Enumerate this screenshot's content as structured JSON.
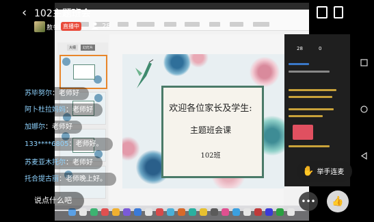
{
  "header": {
    "back_label": "‹",
    "title": "102主题班会",
    "host_name": "敖冬",
    "live_badge": "直播中",
    "viewer_icon": "person-icon",
    "viewer_count": "28"
  },
  "slide": {
    "greeting": "欢迎各位家长及学生:",
    "subtitle": "主题班会课",
    "class_name": "102班"
  },
  "ppt": {
    "tab_outline": "大纲",
    "tab_slides": "幻灯片"
  },
  "panel": {
    "stat_a": "28",
    "stat_b": "0"
  },
  "chat": [
    {
      "user": "苏毕努尔",
      "message": "老师好"
    },
    {
      "user": "阿卜杜拉妈妈",
      "message": "老师好"
    },
    {
      "user": "加娜尔",
      "message": "老师好"
    },
    {
      "user": "133****6805",
      "message": "老师好。"
    },
    {
      "user": "苏麦亚木托尔",
      "message": "老师好"
    },
    {
      "user": "托合提古丽",
      "message": "老师晚上好。"
    }
  ],
  "controls": {
    "say_something": "说点什么吧",
    "raise_hand": "举手连麦",
    "more": "•••",
    "like_icon": "thumb-up-icon"
  },
  "colors": {
    "live_badge": "#e94a3a",
    "username": "#8fd3ff",
    "slide_frame": "#4a7a68"
  }
}
